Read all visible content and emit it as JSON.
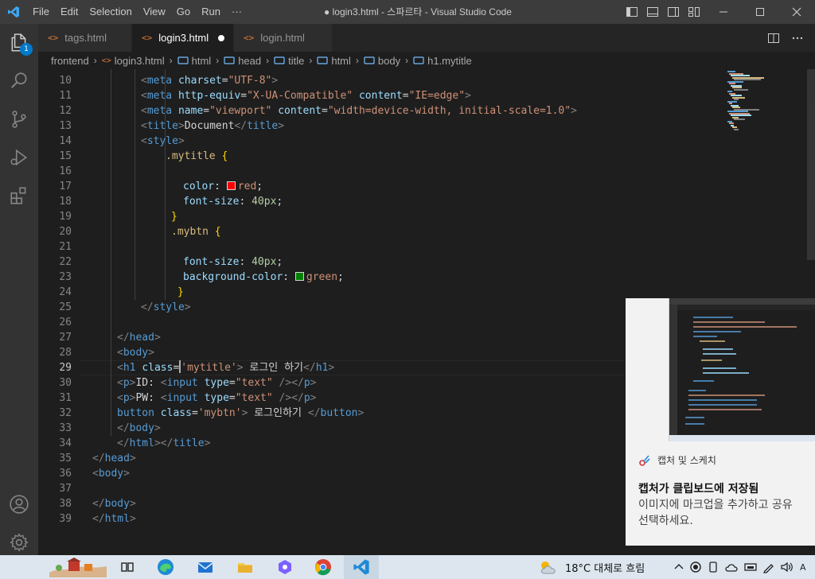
{
  "titlebar": {
    "menu": [
      "File",
      "Edit",
      "Selection",
      "View",
      "Go",
      "Run",
      "···"
    ],
    "window_title": "● login3.html - 스파르타 - Visual Studio Code"
  },
  "activity": {
    "explorer_badge": "1"
  },
  "tabs": [
    {
      "label": "tags.html",
      "icon": "html-icon",
      "active": false,
      "dirty": false
    },
    {
      "label": "login3.html",
      "icon": "html-icon",
      "active": true,
      "dirty": true
    },
    {
      "label": "login.html",
      "icon": "html-icon",
      "active": false,
      "dirty": false
    }
  ],
  "breadcrumb": [
    "frontend",
    "login3.html",
    "html",
    "head",
    "title",
    "html",
    "body",
    "h1.mytitle"
  ],
  "editor": {
    "current_line": 29,
    "line_numbers": [
      "10",
      "11",
      "12",
      "13",
      "14",
      "15",
      "16",
      "17",
      "18",
      "19",
      "20",
      "21",
      "22",
      "23",
      "24",
      "25",
      "26",
      "27",
      "28",
      "29",
      "30",
      "31",
      "32",
      "33",
      "34",
      "35",
      "36",
      "37",
      "38",
      "39"
    ],
    "colors": {
      "red_swatch": "#ff0000",
      "green_swatch": "#008000"
    },
    "lines": [
      [
        {
          "c": "p",
          "t": "<"
        },
        {
          "c": "t",
          "t": "meta"
        },
        {
          "c": "d",
          "t": " "
        },
        {
          "c": "a",
          "t": "charset"
        },
        {
          "c": "d",
          "t": "="
        },
        {
          "c": "s",
          "t": "\"UTF-8\""
        },
        {
          "c": "p",
          "t": ">"
        }
      ],
      [
        {
          "c": "p",
          "t": "<"
        },
        {
          "c": "t",
          "t": "meta"
        },
        {
          "c": "d",
          "t": " "
        },
        {
          "c": "a",
          "t": "http-equiv"
        },
        {
          "c": "d",
          "t": "="
        },
        {
          "c": "s",
          "t": "\"X-UA-Compatible\""
        },
        {
          "c": "d",
          "t": " "
        },
        {
          "c": "a",
          "t": "content"
        },
        {
          "c": "d",
          "t": "="
        },
        {
          "c": "s",
          "t": "\"IE=edge\""
        },
        {
          "c": "p",
          "t": ">"
        }
      ],
      [
        {
          "c": "p",
          "t": "<"
        },
        {
          "c": "t",
          "t": "meta"
        },
        {
          "c": "d",
          "t": " "
        },
        {
          "c": "a",
          "t": "name"
        },
        {
          "c": "d",
          "t": "="
        },
        {
          "c": "s",
          "t": "\"viewport\""
        },
        {
          "c": "d",
          "t": " "
        },
        {
          "c": "a",
          "t": "content"
        },
        {
          "c": "d",
          "t": "="
        },
        {
          "c": "s",
          "t": "\"width=device-width, initial-scale=1.0\""
        },
        {
          "c": "p",
          "t": ">"
        }
      ],
      [
        {
          "c": "p",
          "t": "<"
        },
        {
          "c": "t",
          "t": "title"
        },
        {
          "c": "p",
          "t": ">"
        },
        {
          "c": "d",
          "t": "Document"
        },
        {
          "c": "p",
          "t": "</"
        },
        {
          "c": "t",
          "t": "title"
        },
        {
          "c": "p",
          "t": ">"
        }
      ],
      [
        {
          "c": "p",
          "t": "<"
        },
        {
          "c": "t",
          "t": "style"
        },
        {
          "c": "p",
          "t": ">"
        }
      ],
      [
        {
          "c": "sel",
          "t": ".mytitle"
        },
        {
          "c": "d",
          "t": " "
        },
        {
          "c": "brace",
          "t": "{"
        }
      ],
      [],
      [
        {
          "c": "a",
          "t": "color"
        },
        {
          "c": "d",
          "t": ": "
        },
        {
          "c": "swatch",
          "t": "red_swatch"
        },
        {
          "c": "val",
          "t": "red"
        },
        {
          "c": "d",
          "t": ";"
        }
      ],
      [
        {
          "c": "a",
          "t": "font-size"
        },
        {
          "c": "d",
          "t": ": "
        },
        {
          "c": "num",
          "t": "40px"
        },
        {
          "c": "d",
          "t": ";"
        }
      ],
      [
        {
          "c": "brace",
          "t": "}"
        }
      ],
      [
        {
          "c": "sel",
          "t": ".mybtn"
        },
        {
          "c": "d",
          "t": " "
        },
        {
          "c": "brace",
          "t": "{"
        }
      ],
      [],
      [
        {
          "c": "a",
          "t": "font-size"
        },
        {
          "c": "d",
          "t": ": "
        },
        {
          "c": "num",
          "t": "40px"
        },
        {
          "c": "d",
          "t": ";"
        }
      ],
      [
        {
          "c": "a",
          "t": "background-color"
        },
        {
          "c": "d",
          "t": ": "
        },
        {
          "c": "swatch",
          "t": "green_swatch"
        },
        {
          "c": "val",
          "t": "green"
        },
        {
          "c": "d",
          "t": ";"
        }
      ],
      [
        {
          "c": "brace",
          "t": "}"
        }
      ],
      [
        {
          "c": "p",
          "t": "</"
        },
        {
          "c": "t",
          "t": "style"
        },
        {
          "c": "p",
          "t": ">"
        }
      ],
      [],
      [
        {
          "c": "p",
          "t": "</"
        },
        {
          "c": "t",
          "t": "head"
        },
        {
          "c": "p",
          "t": ">"
        }
      ],
      [
        {
          "c": "p",
          "t": "<"
        },
        {
          "c": "t",
          "t": "body"
        },
        {
          "c": "p",
          "t": ">"
        }
      ],
      [
        {
          "c": "p",
          "t": "<"
        },
        {
          "c": "t",
          "t": "h1"
        },
        {
          "c": "d",
          "t": " "
        },
        {
          "c": "a",
          "t": "class"
        },
        {
          "c": "d",
          "t": "="
        },
        {
          "c": "cursor",
          "t": ""
        },
        {
          "c": "s",
          "t": "'mytitle'"
        },
        {
          "c": "p",
          "t": ">"
        },
        {
          "c": "d",
          "t": " 로그인 하기"
        },
        {
          "c": "p",
          "t": "</"
        },
        {
          "c": "t",
          "t": "h1"
        },
        {
          "c": "p",
          "t": ">"
        }
      ],
      [
        {
          "c": "p",
          "t": "<"
        },
        {
          "c": "t",
          "t": "p"
        },
        {
          "c": "p",
          "t": ">"
        },
        {
          "c": "d",
          "t": "ID: "
        },
        {
          "c": "p",
          "t": "<"
        },
        {
          "c": "t",
          "t": "input"
        },
        {
          "c": "d",
          "t": " "
        },
        {
          "c": "a",
          "t": "type"
        },
        {
          "c": "d",
          "t": "="
        },
        {
          "c": "s",
          "t": "\"text\""
        },
        {
          "c": "d",
          "t": " "
        },
        {
          "c": "p",
          "t": "/></"
        },
        {
          "c": "t",
          "t": "p"
        },
        {
          "c": "p",
          "t": ">"
        }
      ],
      [
        {
          "c": "p",
          "t": "<"
        },
        {
          "c": "t",
          "t": "p"
        },
        {
          "c": "p",
          "t": ">"
        },
        {
          "c": "d",
          "t": "PW: "
        },
        {
          "c": "p",
          "t": "<"
        },
        {
          "c": "t",
          "t": "input"
        },
        {
          "c": "d",
          "t": " "
        },
        {
          "c": "a",
          "t": "type"
        },
        {
          "c": "d",
          "t": "="
        },
        {
          "c": "s",
          "t": "\"text\""
        },
        {
          "c": "d",
          "t": " "
        },
        {
          "c": "p",
          "t": "/></"
        },
        {
          "c": "t",
          "t": "p"
        },
        {
          "c": "p",
          "t": ">"
        }
      ],
      [
        {
          "c": "t",
          "t": "button"
        },
        {
          "c": "d",
          "t": " "
        },
        {
          "c": "a",
          "t": "class"
        },
        {
          "c": "d",
          "t": "="
        },
        {
          "c": "s",
          "t": "'mybtn'"
        },
        {
          "c": "p",
          "t": ">"
        },
        {
          "c": "d",
          "t": " 로그인하기 "
        },
        {
          "c": "p",
          "t": "</"
        },
        {
          "c": "t",
          "t": "button"
        },
        {
          "c": "p",
          "t": ">"
        }
      ],
      [
        {
          "c": "p",
          "t": "</"
        },
        {
          "c": "t",
          "t": "body"
        },
        {
          "c": "p",
          "t": ">"
        }
      ],
      [
        {
          "c": "p",
          "t": "</"
        },
        {
          "c": "t",
          "t": "html"
        },
        {
          "c": "p",
          "t": "></"
        },
        {
          "c": "t",
          "t": "title"
        },
        {
          "c": "p",
          "t": ">"
        }
      ],
      [
        {
          "c": "p",
          "t": "</"
        },
        {
          "c": "t",
          "t": "head"
        },
        {
          "c": "p",
          "t": ">"
        }
      ],
      [
        {
          "c": "p",
          "t": "<"
        },
        {
          "c": "t",
          "t": "body"
        },
        {
          "c": "p",
          "t": ">"
        }
      ],
      [],
      [
        {
          "c": "p",
          "t": "</"
        },
        {
          "c": "t",
          "t": "body"
        },
        {
          "c": "p",
          "t": ">"
        }
      ],
      [
        {
          "c": "p",
          "t": "</"
        },
        {
          "c": "t",
          "t": "html"
        },
        {
          "c": "p",
          "t": ">"
        }
      ]
    ]
  },
  "toast": {
    "app_name": "캡처 및 스케치",
    "title": "캡처가 클립보드에 저장됨",
    "body_line1": "이미지에 마크업을 추가하고 공유",
    "body_line2": "선택하세요."
  },
  "taskbar": {
    "weather": "18°C  대체로 흐림"
  }
}
